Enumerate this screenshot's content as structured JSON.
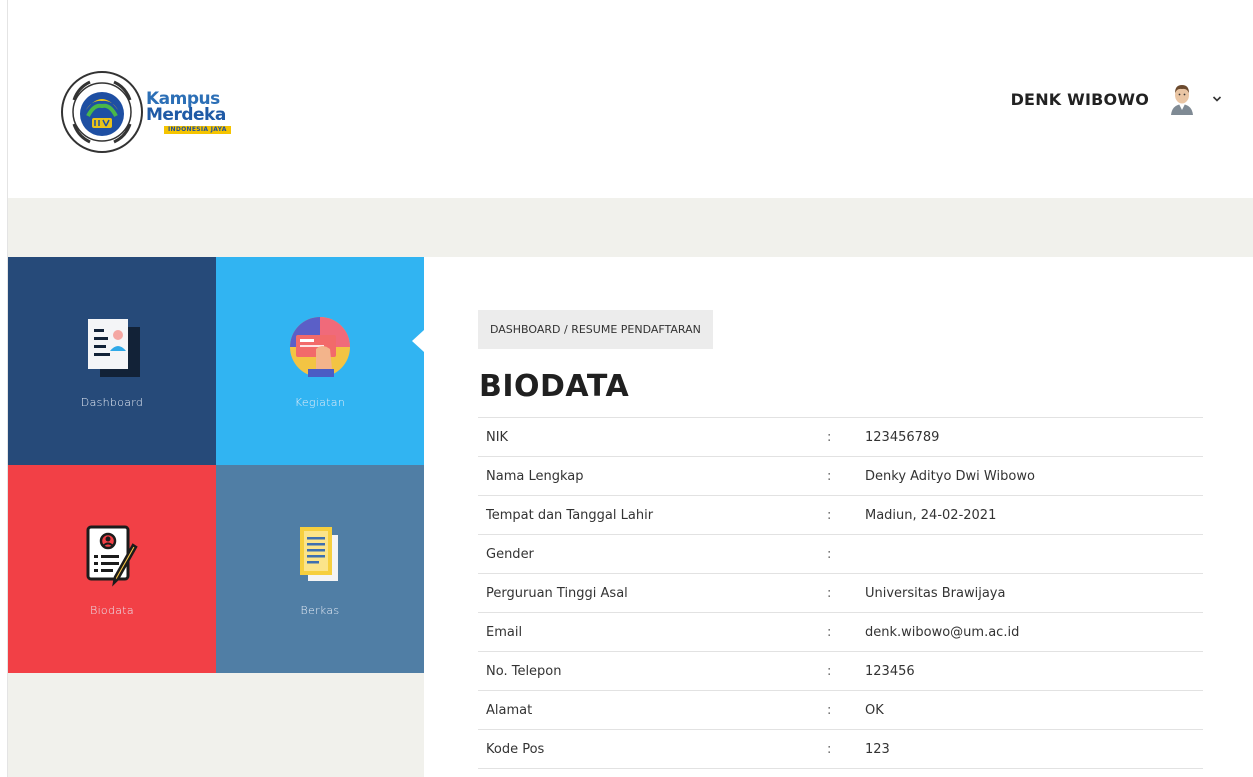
{
  "header": {
    "brand_line1": "Kampus",
    "brand_line2": "Merdeka",
    "brand_tagline": "INDONESIA JAYA",
    "user_name": "DENK WIBOWO"
  },
  "sidebar": {
    "tiles": [
      {
        "label": "Dashboard",
        "color": "#264a79"
      },
      {
        "label": "Kegiatan",
        "color": "#31b4f2",
        "active": true
      },
      {
        "label": "Biodata",
        "color": "#f24046"
      },
      {
        "label": "Berkas",
        "color": "#507ea5"
      }
    ]
  },
  "main": {
    "breadcrumb": "DASHBOARD / RESUME PENDAFTARAN",
    "title": "BIODATA",
    "separator": ":",
    "rows": [
      {
        "label": "NIK",
        "value": "123456789"
      },
      {
        "label": "Nama Lengkap",
        "value": "Denky Adityo Dwi Wibowo"
      },
      {
        "label": "Tempat dan Tanggal Lahir",
        "value": "Madiun, 24-02-2021"
      },
      {
        "label": "Gender",
        "value": ""
      },
      {
        "label": "Perguruan Tinggi Asal",
        "value": "Universitas Brawijaya"
      },
      {
        "label": "Email",
        "value": "denk.wibowo@um.ac.id"
      },
      {
        "label": "No. Telepon",
        "value": "123456"
      },
      {
        "label": "Alamat",
        "value": "OK"
      },
      {
        "label": "Kode Pos",
        "value": "123"
      }
    ]
  },
  "colors": {
    "band": "#f1f1ec",
    "accent": "#31b4f2"
  }
}
